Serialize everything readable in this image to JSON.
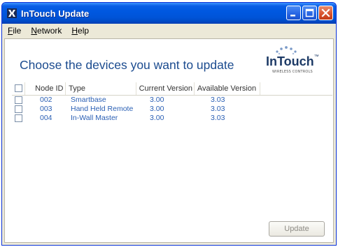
{
  "window": {
    "title": "InTouch Update"
  },
  "menu": {
    "items": [
      {
        "key": "F",
        "rest": "ile"
      },
      {
        "key": "N",
        "rest": "etwork"
      },
      {
        "key": "H",
        "rest": "elp"
      }
    ]
  },
  "heading": "Choose the devices you want to update",
  "logo": {
    "word": "InTouch",
    "tm": "™",
    "subtitle": "WIRELESS CONTROLS"
  },
  "table": {
    "columns": [
      "Node ID",
      "Type",
      "Current Version",
      "Available Version"
    ],
    "rows": [
      {
        "node_id": "002",
        "type": "Smartbase",
        "current": "3.00",
        "available": "3.03",
        "checked": false
      },
      {
        "node_id": "003",
        "type": "Hand Held Remote",
        "current": "3.00",
        "available": "3.03",
        "checked": false
      },
      {
        "node_id": "004",
        "type": "In-Wall Master",
        "current": "3.00",
        "available": "3.03",
        "checked": false
      }
    ]
  },
  "buttons": {
    "update": "Update"
  },
  "colors": {
    "titlebar": "#0054d8",
    "heading": "#1b4b8f",
    "row_text": "#2a5fb4",
    "close": "#d8512d"
  }
}
